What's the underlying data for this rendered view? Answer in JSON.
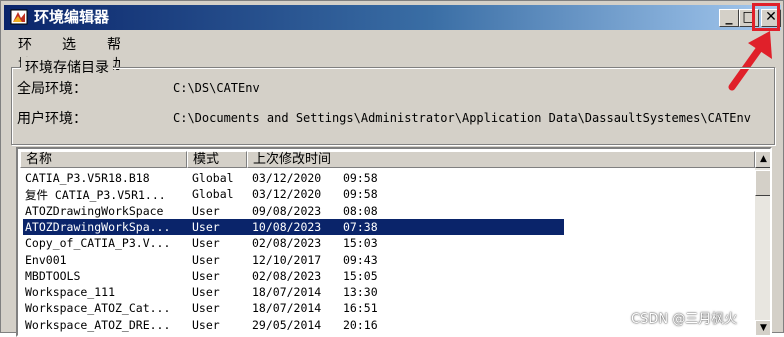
{
  "window": {
    "title": "环境编辑器",
    "minimize": "_",
    "maximize": "□",
    "close": "✕"
  },
  "menu": [
    "环境",
    "选项",
    "帮助"
  ],
  "storage": {
    "group_title": "环境存储目录",
    "global_label": "全局环境：",
    "global_value": "C:\\DS\\CATEnv",
    "user_label": "用户环境：",
    "user_value": "C:\\Documents and Settings\\Administrator\\Application Data\\DassaultSystemes\\CATEnv"
  },
  "list": {
    "columns": [
      "名称",
      "模式",
      "上次修改时间"
    ],
    "rows": [
      {
        "name": "CATIA_P3.V5R18.B18",
        "mode": "Global",
        "date": "03/12/2020",
        "time": "09:58",
        "selected": false
      },
      {
        "name": "复件 CATIA_P3.V5R1...",
        "mode": "Global",
        "date": "03/12/2020",
        "time": "09:58",
        "selected": false
      },
      {
        "name": "ATOZDrawingWorkSpace",
        "mode": "User",
        "date": "09/08/2023",
        "time": "08:08",
        "selected": false
      },
      {
        "name": "ATOZDrawingWorkSpa...",
        "mode": "User",
        "date": "10/08/2023",
        "time": "07:38",
        "selected": true
      },
      {
        "name": "Copy_of_CATIA_P3.V...",
        "mode": "User",
        "date": "02/08/2023",
        "time": "15:03",
        "selected": false
      },
      {
        "name": "Env001",
        "mode": "User",
        "date": "12/10/2017",
        "time": "09:43",
        "selected": false
      },
      {
        "name": "MBDTOOLS",
        "mode": "User",
        "date": "02/08/2023",
        "time": "15:05",
        "selected": false
      },
      {
        "name": "Workspace_111",
        "mode": "User",
        "date": "18/07/2014",
        "time": "13:30",
        "selected": false
      },
      {
        "name": "Workspace_ATOZ_Cat...",
        "mode": "User",
        "date": "18/07/2014",
        "time": "16:51",
        "selected": false
      },
      {
        "name": "Workspace_ATOZ_DRE...",
        "mode": "User",
        "date": "29/05/2014",
        "time": "20:16",
        "selected": false
      }
    ]
  },
  "scrollbar": {
    "up": "▲",
    "down": "▼"
  },
  "watermark": "CSDN @三月枫火",
  "colors": {
    "selection": "#0a246a",
    "annotation": "#e0202a"
  }
}
